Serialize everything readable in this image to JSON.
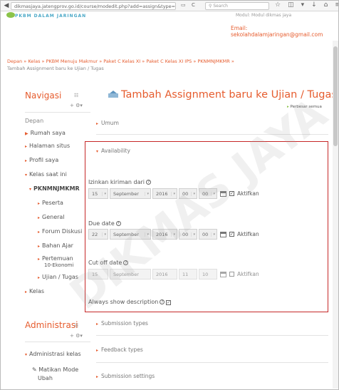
{
  "browser": {
    "url_prefix": "dikmasjaya.jatengprov.go.id/course/modedit.php?add=assign&type=",
    "search_placeholder": "Search"
  },
  "header": {
    "site_name": "PKBM DALAM JARINGAN",
    "top_right": "Modul: Modul dikmas jaya",
    "email": "Email: sekolahdalamjaringan@gmail.com"
  },
  "breadcrumb": {
    "line1": "Depan » Kelas » PKBM Menuju Makmur » Paket C Kelas XI » Paket C Kelas XI IPS » PKNMNJMKMR »",
    "line2": "Tambah Assignment baru ke Ujian / Tugas"
  },
  "sidebar": {
    "nav_title": "Navigasi",
    "items": [
      "Depan",
      "Rumah saya",
      "Halaman situs",
      "Profil saya",
      "Kelas saat ini",
      "PKNMNJMKMR",
      "Peserta",
      "General",
      "Forum Diskusi",
      "Bahan Ajar",
      "Pertemuan",
      "10-Ekonomi",
      "Ujian / Tugas",
      "Kelas"
    ],
    "admin_title": "Administrasi",
    "admin_items": [
      "Administrasi kelas",
      "Matikan Mode",
      "Ubah"
    ]
  },
  "main": {
    "title": "Tambah Assignment baru ke Ujian / Tugas",
    "expand_all": "Perbesar semua",
    "section_general": "Umum",
    "section_availability": "Availability",
    "allow_label": "Izinkan kiriman dari",
    "due_label": "Due date",
    "cutoff_label": "Cut off date",
    "always_show": "Always show description",
    "allow": {
      "day": "15",
      "month": "September",
      "year": "2016",
      "hour": "00",
      "minute": "00"
    },
    "due": {
      "day": "22",
      "month": "September",
      "year": "2016",
      "hour": "00",
      "minute": "00"
    },
    "cutoff": {
      "day": "15",
      "month": "September",
      "year": "2016",
      "hour": "11",
      "minute": "10"
    },
    "enable_label": "Aktifkan",
    "section_submission_types": "Submission types",
    "section_feedback_types": "Feedback types",
    "section_submission_settings": "Submission settings"
  },
  "watermark": "DIKMAS JAYA",
  "colors": {
    "accent": "#e65c2e",
    "highlight_box": "#c62828",
    "green": "#8bc34a"
  }
}
